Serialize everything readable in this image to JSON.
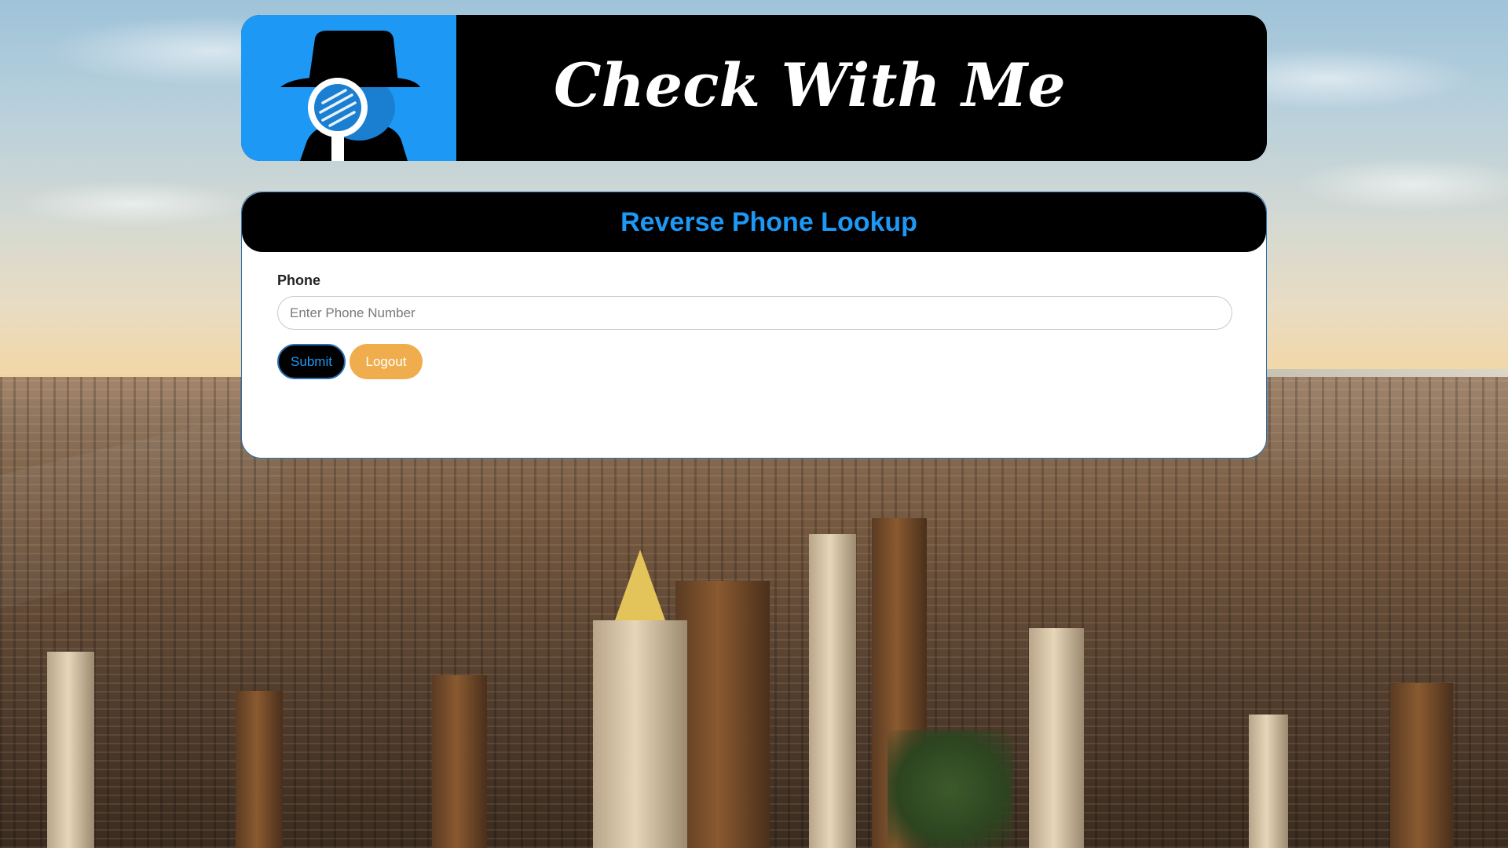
{
  "header": {
    "site_title": "Check With Me",
    "logo_icon": "detective-magnifier-icon",
    "logo_bg_color": "#1e98f5"
  },
  "lookup": {
    "title": "Reverse Phone Lookup",
    "phone_label": "Phone",
    "phone_placeholder": "Enter Phone Number",
    "phone_value": "",
    "submit_label": "Submit",
    "logout_label": "Logout"
  },
  "colors": {
    "accent_blue": "#1e98f5",
    "logout_orange": "#f0ad4e",
    "banner_black": "#000000"
  }
}
